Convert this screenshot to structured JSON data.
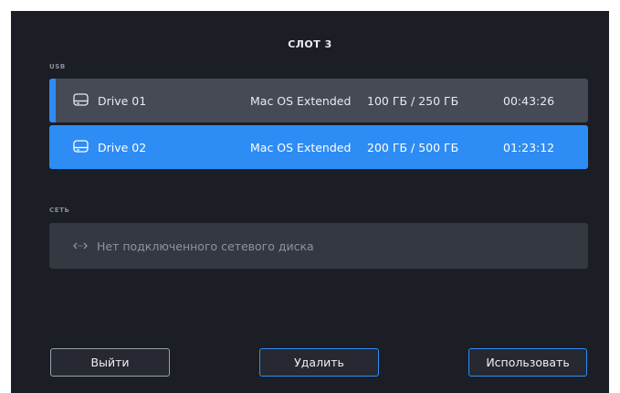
{
  "title": "СЛОТ 3",
  "sections": {
    "usb_label": "USB",
    "network_label": "СЕТЬ"
  },
  "drives": [
    {
      "name": "Drive 01",
      "format": "Mac OS Extended",
      "space": "100 ГБ / 250 ГБ",
      "time": "00:43:26",
      "state": "current"
    },
    {
      "name": "Drive 02",
      "format": "Mac OS Extended",
      "space": "200 ГБ / 500 ГБ",
      "time": "01:23:12",
      "state": "selected"
    }
  ],
  "network": {
    "icon": "network-link-icon",
    "empty_text": "Нет подключенного сетевого диска"
  },
  "buttons": {
    "exit": "Выйти",
    "delete": "Удалить",
    "use": "Использовать"
  },
  "colors": {
    "accent": "#2e8cf5",
    "background": "#1b1e24",
    "row_current": "#454a54",
    "network_box": "#343841"
  }
}
